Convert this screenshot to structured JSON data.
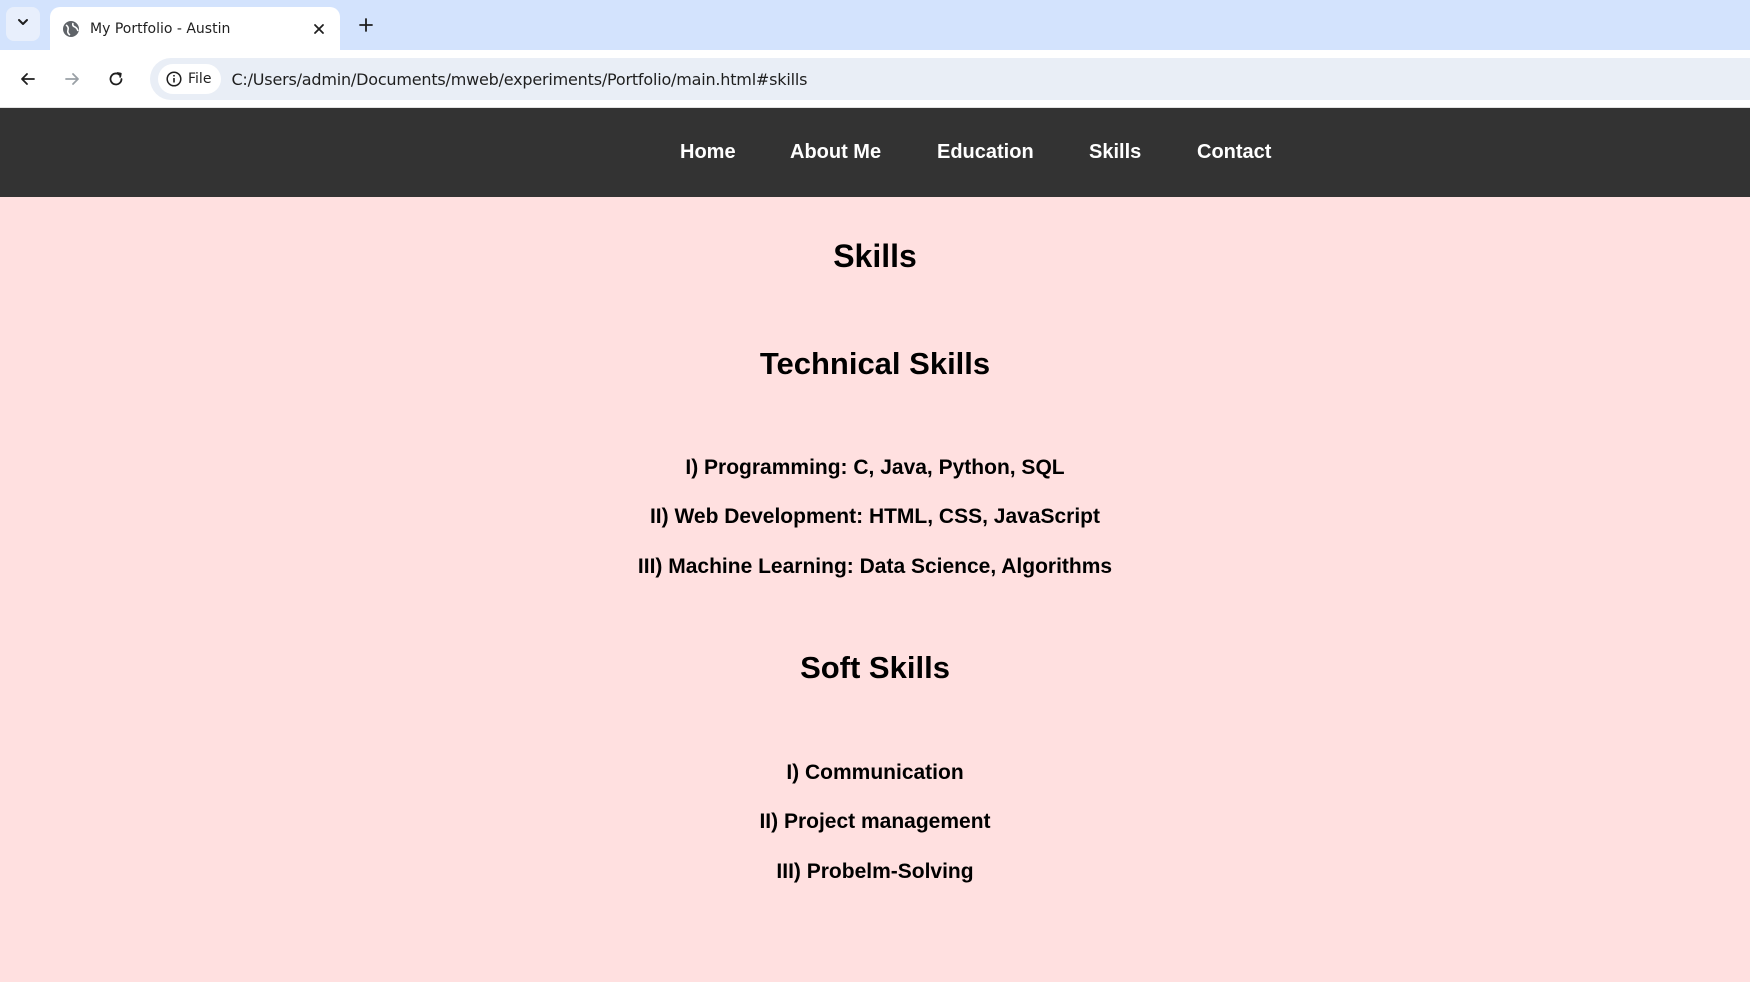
{
  "browser": {
    "tab_title": "My Portfolio - Austin",
    "chip_label": "File",
    "url": "C:/Users/admin/Documents/mweb/experiments/Portfolio/main.html#skills"
  },
  "nav": {
    "items": [
      "Home",
      "About Me",
      "Education",
      "Skills",
      "Contact"
    ]
  },
  "skills": {
    "title": "Skills",
    "technical": {
      "heading": "Technical Skills",
      "items": [
        "I) Programming: C, Java, Python, SQL",
        "II) Web Development: HTML, CSS, JavaScript",
        "III) Machine Learning: Data Science, Algorithms"
      ]
    },
    "soft": {
      "heading": "Soft Skills",
      "items": [
        "I) Communication",
        "II) Project management",
        "III) Probelm-Solving"
      ]
    }
  },
  "colors": {
    "page_bg": "#ffe0e0",
    "nav_bg": "#333333",
    "nav_text": "#ffffff",
    "tabstrip_bg": "#d3e3fd"
  },
  "icons": {
    "tab_search": "chevron-down-icon",
    "favicon": "globe-icon",
    "tab_close": "close-icon",
    "new_tab": "plus-icon",
    "back": "arrow-left-icon",
    "forward": "arrow-right-icon",
    "reload": "reload-icon",
    "site_info": "info-icon"
  }
}
